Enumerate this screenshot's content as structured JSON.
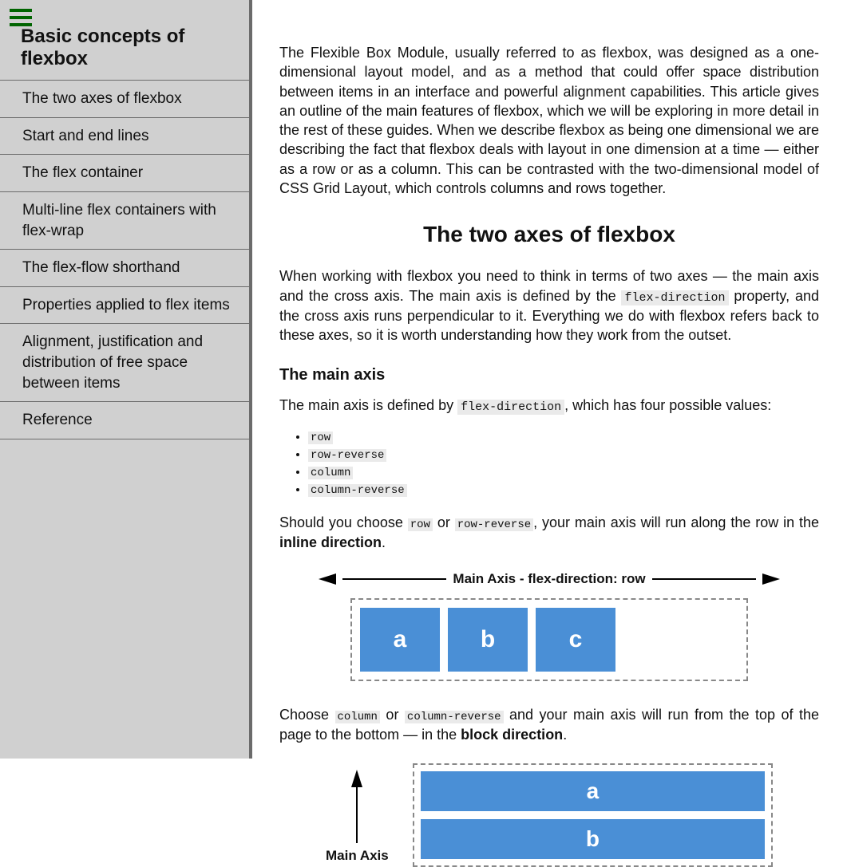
{
  "sidebar": {
    "title": "Basic concepts of flexbox",
    "items": [
      "The two axes of flexbox",
      "Start and end lines",
      "The flex container",
      "Multi-line flex containers with flex-wrap",
      "The flex-flow shorthand",
      "Properties applied to flex items",
      "Alignment, justification and distribution of free space between items",
      "Reference"
    ]
  },
  "intro": "The Flexible Box Module, usually referred to as flexbox, was designed as a one-dimensional layout model, and as a method that could offer space distribution between items in an interface and powerful alignment capabilities. This article gives an outline of the main features of flexbox, which we will be exploring in more detail in the rest of these guides. When we describe flexbox as being one dimensional we are describing the fact that flexbox deals with layout in one dimension at a time — either as a row or as a column. This can be contrasted with the two-dimensional model of CSS Grid Layout, which controls columns and rows together.",
  "section1": {
    "heading": "The two axes of flexbox",
    "para_a": "When working with flexbox you need to think in terms of two axes — the main axis and the cross axis. The main axis is defined by the ",
    "code1": "flex-direction",
    "para_b": " property, and the cross axis runs perpendicular to it. Everything we do with flexbox refers back to these axes, so it is worth understanding how they work from the outset.",
    "sub1": "The main axis",
    "main_axis_a": "The main axis is defined by ",
    "main_axis_code": "flex-direction",
    "main_axis_b": ", which has four possible values:",
    "values": [
      "row",
      "row-reverse",
      "column",
      "column-reverse"
    ],
    "p3_a": "Should you choose ",
    "p3_c1": "row",
    "p3_or": " or ",
    "p3_c2": "row-reverse",
    "p3_b": ", your main axis will run along the row in the ",
    "p3_bold": "inline direction",
    "p3_end": ".",
    "axis_label": "Main Axis - flex-direction: row",
    "boxes": [
      "a",
      "b",
      "c"
    ],
    "p4_a": "Choose ",
    "p4_c1": "column",
    "p4_or": " or ",
    "p4_c2": "column-reverse",
    "p4_b": " and your main axis will run from the top of the page to the bottom — in the ",
    "p4_bold": "block direction",
    "p4_end": ".",
    "axis2_label": "Main Axis",
    "boxes2": [
      "a",
      "b"
    ]
  }
}
